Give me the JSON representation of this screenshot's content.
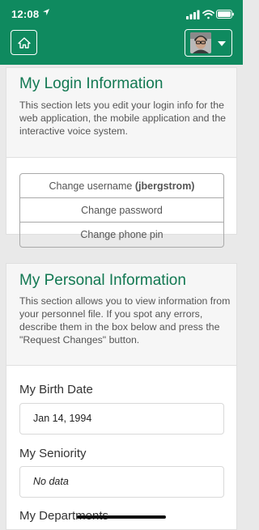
{
  "status_bar": {
    "time": "12:08"
  },
  "header": {
    "home_icon": "home-icon",
    "user_menu_icon": "chevron-down-icon",
    "brand_color": "#0f8a5f"
  },
  "login_section": {
    "title": "My Login Information",
    "description": "This section lets you edit your login info for the web application, the mobile application and the interactive voice system.",
    "change_username_label": "Change username",
    "username": "(jbergstrom)",
    "change_password_label": "Change password",
    "change_phone_pin_label": "Change phone pin"
  },
  "personal_section": {
    "title": "My Personal Information",
    "description": "This section allows you to view information from your personnel file. If you spot any errors, describe them in the box below and press the \"Request Changes\" button.",
    "birth_date_label": "My Birth Date",
    "birth_date_value": "Jan 14, 1994",
    "seniority_label": "My Seniority",
    "seniority_value": "No data",
    "departments_label": "My Departments"
  }
}
